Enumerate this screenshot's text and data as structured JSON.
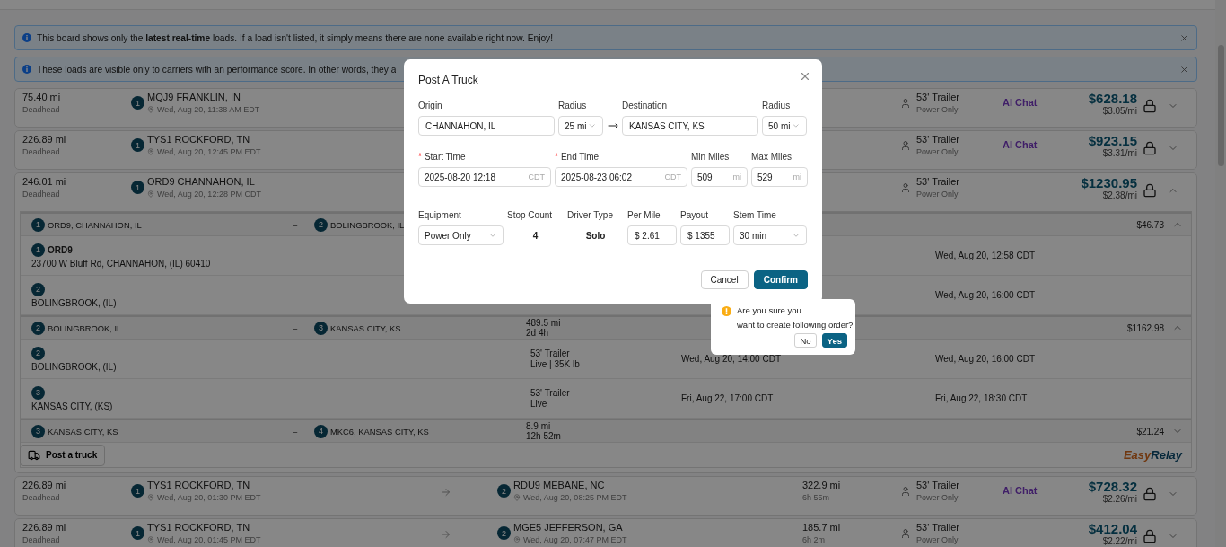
{
  "alerts": [
    {
      "text": "This board shows only the **latest real-time** loads. If a load isn't listed, it simply means there are none available right now. Enjoy!"
    },
    {
      "text": "These loads are visible only to carriers with an performance score. In other words, they a"
    }
  ],
  "loads": [
    {
      "deadhead": "75.40 mi",
      "deadhead_label": "Deadhead",
      "origin": {
        "num": "1",
        "name": "MQJ9 FRANKLIN, IN",
        "time": "Wed, Aug 20, 11:38 AM EDT"
      },
      "equipment": "53' Trailer",
      "equipment_sub": "Power Only",
      "ai_chat": "AI Chat",
      "price": "$628.18",
      "per_mile": "$3.05/mi",
      "expanded": false
    },
    {
      "deadhead": "226.89 mi",
      "deadhead_label": "Deadhead",
      "origin": {
        "num": "1",
        "name": "TYS1 ROCKFORD, TN",
        "time": "Wed, Aug 20, 12:45 PM EDT"
      },
      "equipment": "53' Trailer",
      "equipment_sub": "Power Only",
      "ai_chat": "AI Chat",
      "price": "$923.15",
      "per_mile": "$3.31/mi",
      "expanded": false
    },
    {
      "deadhead": "246.01 mi",
      "deadhead_label": "Deadhead",
      "origin": {
        "num": "1",
        "name": "ORD9 CHANNAHON, IL",
        "time": "Wed, Aug 20, 12:28 PM CDT"
      },
      "equipment": "53' Trailer",
      "equipment_sub": "Power Only",
      "price": "$1230.95",
      "per_mile": "$2.38/mi",
      "expanded": true,
      "segments": [
        {
          "from": {
            "num": "1",
            "name": "ORD9, CHANNAHON, IL"
          },
          "dash": "–",
          "to": {
            "num": "2",
            "name": "BOLINGBROOK, IL"
          },
          "price": "$46.73",
          "expanded": true,
          "stops": [
            {
              "num": "1",
              "name": "ORD9",
              "address": "23700 W Bluff Rd, CHANNAHON, (IL) 60410",
              "time_2": "Wed, Aug 20, 12:58 CDT"
            },
            {
              "num": "2",
              "address": "BOLINGBROOK, (IL)",
              "time_2": "Wed, Aug 20, 16:00 CDT"
            }
          ]
        },
        {
          "from": {
            "num": "2",
            "name": "BOLINGBROOK, IL"
          },
          "dash": "–",
          "to": {
            "num": "3",
            "name": "KANSAS CITY, KS"
          },
          "distance": "489.5 mi",
          "duration": "2d 4h",
          "price": "$1162.98",
          "expanded": true,
          "stops": [
            {
              "num": "2",
              "address": "BOLINGBROOK, (IL)",
              "equipment": "53' Trailer",
              "equipment_sub": "Live | 35K lb",
              "time_1": "Wed, Aug 20, 14:00 CDT",
              "time_2": "Wed, Aug 20, 16:00 CDT"
            },
            {
              "num": "3",
              "address": "KANSAS CITY, (KS)",
              "equipment": "53' Trailer",
              "equipment_sub": "Live",
              "time_1": "Fri, Aug 22, 17:00 CDT",
              "time_2": "Fri, Aug 22, 18:30 CDT"
            }
          ]
        },
        {
          "from": {
            "num": "3",
            "name": "KANSAS CITY, KS"
          },
          "dash": "–",
          "to": {
            "num": "4",
            "name": "MKC6, KANSAS CITY, KS"
          },
          "distance": "8.9 mi",
          "duration": "12h 52m",
          "price": "$21.24",
          "expanded": false
        }
      ],
      "post_button": "Post a truck",
      "logo": [
        "Easy",
        "Relay"
      ]
    },
    {
      "deadhead": "226.89 mi",
      "deadhead_label": "Deadhead",
      "origin": {
        "num": "1",
        "name": "TYS1 ROCKFORD, TN",
        "time": "Wed, Aug 20, 01:30 PM EDT"
      },
      "destination": {
        "num": "2",
        "name": "RDU9 MEBANE, NC",
        "time": "Wed, Aug 20, 08:25 PM EDT"
      },
      "distance": "322.9 mi",
      "duration": "6h 55m",
      "equipment": "53' Trailer",
      "equipment_sub": "Power Only",
      "ai_chat": "AI Chat",
      "price": "$728.32",
      "per_mile": "$2.26/mi",
      "expanded": false
    },
    {
      "deadhead": "226.89 mi",
      "deadhead_label": "Deadhead",
      "origin": {
        "num": "1",
        "name": "TYS1 ROCKFORD, TN",
        "time": "Wed, Aug 20, 01:45 PM EDT"
      },
      "destination": {
        "num": "2",
        "name": "MGE5 JEFFERSON, GA",
        "time": "Wed, Aug 20, 07:47 PM EDT"
      },
      "distance": "185.7 mi",
      "duration": "6h 2m",
      "equipment": "53' Trailer",
      "equipment_sub": "Power Only",
      "price": "$412.04",
      "per_mile": "$2.22/mi",
      "expanded": false
    }
  ],
  "dialog": {
    "title": "Post A Truck",
    "sections": [
      {
        "fields": [
          {
            "kind": "input",
            "label": "Origin",
            "value": "CHANNAHON, IL"
          },
          {
            "kind": "select",
            "label": "Radius",
            "value": "25 mi"
          },
          {
            "kind": "arrow"
          },
          {
            "kind": "input",
            "label": "Destination",
            "value": "KANSAS CITY, KS"
          },
          {
            "kind": "select",
            "label": "Radius",
            "value": "50 mi"
          }
        ]
      },
      {
        "fields": [
          {
            "kind": "suffixed",
            "label": "Start Time",
            "required_mark": "*",
            "value": "2025-08-20 12:18",
            "suffix": "CDT"
          },
          {
            "kind": "suffixed",
            "label": "End Time",
            "required_mark": "*",
            "value": "2025-08-23 06:02",
            "suffix": "CDT"
          },
          {
            "kind": "suffixed",
            "label": "Min Miles",
            "value": "509",
            "suffix": "mi"
          },
          {
            "kind": "suffixed",
            "label": "Max Miles",
            "value": "529",
            "suffix": "mi"
          }
        ]
      },
      {
        "fields": [
          {
            "kind": "select",
            "label": "Equipment",
            "value": "Power Only"
          },
          {
            "kind": "static",
            "label": "Stop Count",
            "value": "4"
          },
          {
            "kind": "static",
            "label": "Driver Type",
            "value": "Solo"
          },
          {
            "kind": "input",
            "label": "Per Mile",
            "value": "$ 2.61"
          },
          {
            "kind": "input",
            "label": "Payout",
            "value": "$ 1355"
          },
          {
            "kind": "select",
            "label": "Stem Time",
            "value": "30 min"
          }
        ]
      }
    ],
    "buttons": [
      {
        "label": "Cancel",
        "primary": false
      },
      {
        "label": "Confirm",
        "primary": true
      }
    ]
  },
  "popconfirm": {
    "message_lines": [
      "Are you sure you",
      "want to create following order?"
    ],
    "buttons": [
      {
        "label": "No",
        "primary": false
      },
      {
        "label": "Yes",
        "primary": true
      }
    ]
  }
}
